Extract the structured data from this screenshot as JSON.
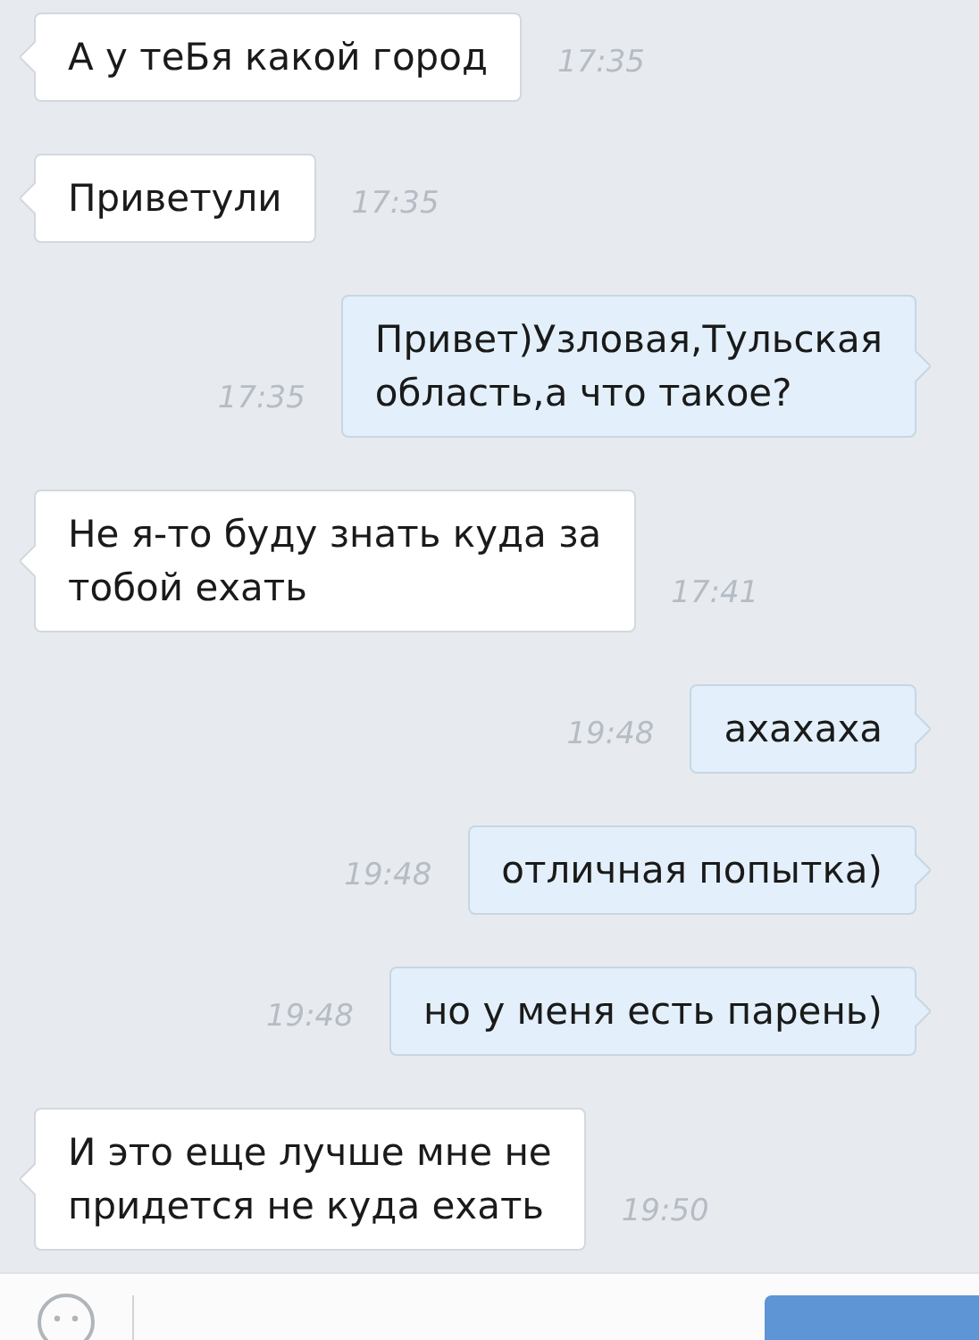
{
  "messages": [
    {
      "kind": "incoming",
      "lines": [
        "А у теБя какой город"
      ],
      "time": "17:35"
    },
    {
      "kind": "incoming",
      "lines": [
        "Приветули"
      ],
      "time": "17:35"
    },
    {
      "kind": "outgoing",
      "lines": [
        "Привет)Узловая,Тульская",
        "область,а что такое?"
      ],
      "time": "17:35"
    },
    {
      "kind": "incoming",
      "lines": [
        "Не я-то буду знать куда за",
        "тобой ехать"
      ],
      "time": "17:41"
    },
    {
      "kind": "outgoing",
      "lines": [
        "ахахаха"
      ],
      "time": "19:48"
    },
    {
      "kind": "outgoing",
      "lines": [
        "отличная попытка)"
      ],
      "time": "19:48"
    },
    {
      "kind": "outgoing",
      "lines": [
        "но у меня есть парень)"
      ],
      "time": "19:48"
    },
    {
      "kind": "incoming",
      "lines": [
        "И это еще лучше мне не",
        "придется не куда ехать"
      ],
      "time": "19:50"
    }
  ]
}
